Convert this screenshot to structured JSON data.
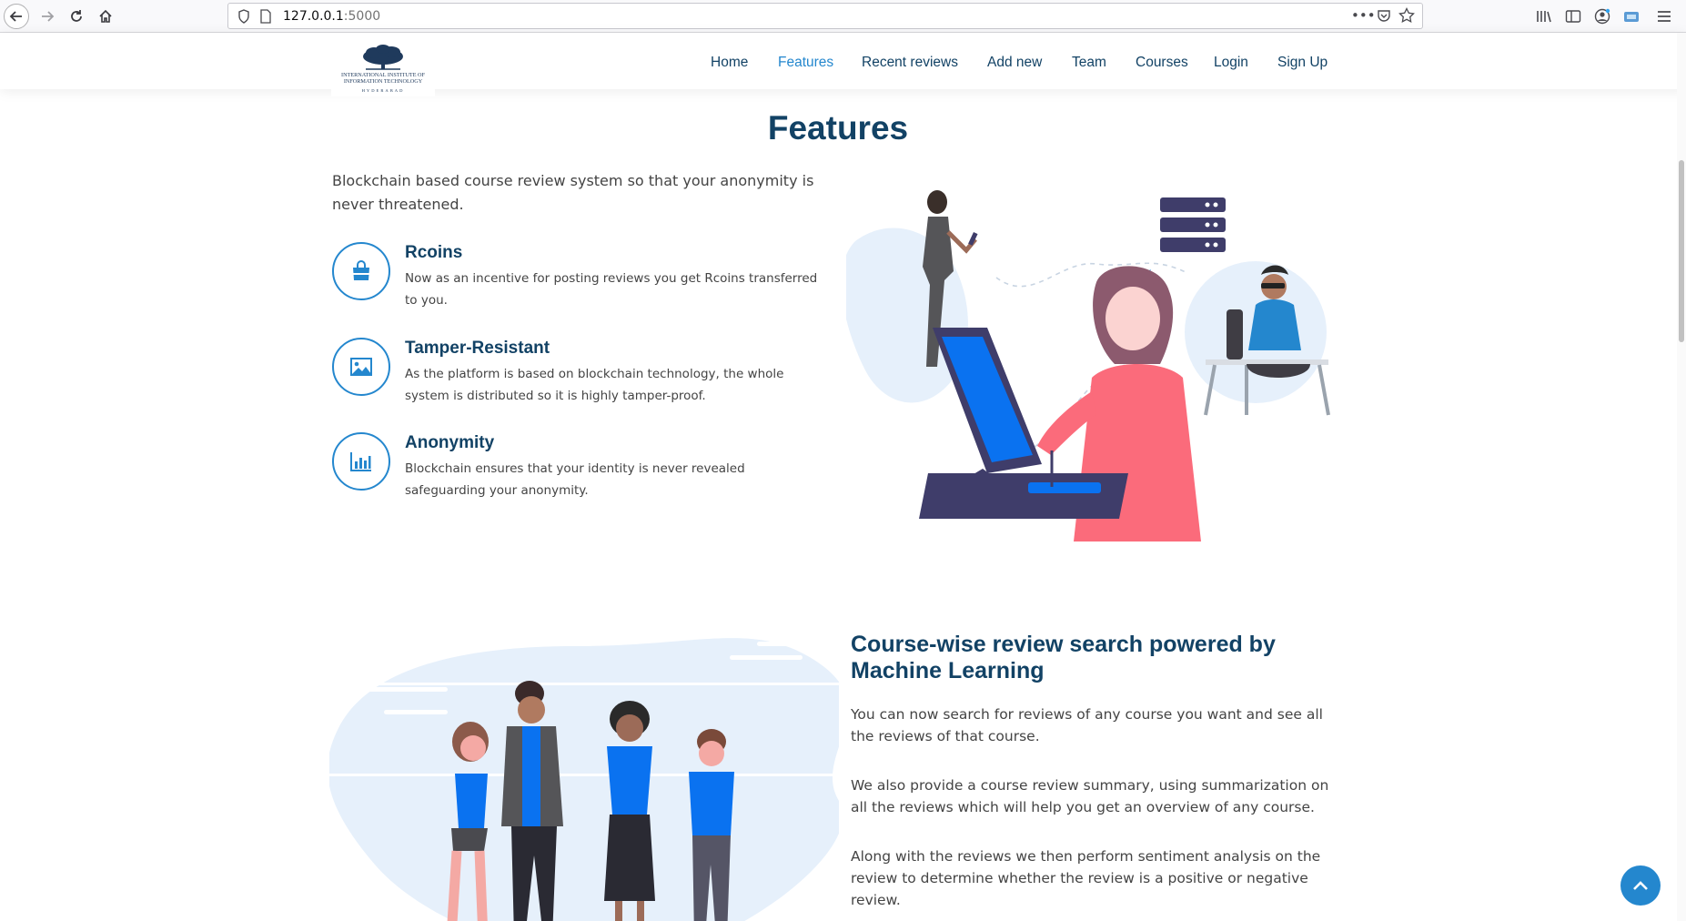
{
  "browser": {
    "url_host": "127.0.0.1",
    "url_port": ":5000"
  },
  "nav": {
    "items": [
      {
        "label": "Home",
        "active": false
      },
      {
        "label": "Features",
        "active": true
      },
      {
        "label": "Recent reviews",
        "active": false
      },
      {
        "label": "Add new",
        "active": false
      },
      {
        "label": "Team",
        "active": false
      },
      {
        "label": "Courses",
        "active": false
      },
      {
        "label": "Login",
        "active": false
      },
      {
        "label": "Sign Up",
        "active": false
      }
    ]
  },
  "logo": {
    "line1": "INTERNATIONAL INSTITUTE OF",
    "line2": "INFORMATION TECHNOLOGY",
    "line3": "HYDERABAD"
  },
  "features_section": {
    "title": "Features",
    "intro": "Blockchain based course review system so that your anonymity is never threatened.",
    "items": [
      {
        "title": "Rcoins",
        "description": "Now as an incentive for posting reviews you get Rcoins transferred to you.",
        "icon": "shopping-bag-icon"
      },
      {
        "title": "Tamper-Resistant",
        "description": "As the platform is based on blockchain technology, the whole system is distributed so it is highly tamper-proof.",
        "icon": "image-icon"
      },
      {
        "title": "Anonymity",
        "description": "Blockchain ensures that your identity is never revealed safeguarding your anonymity.",
        "icon": "bar-chart-icon"
      }
    ]
  },
  "ml_section": {
    "title": "Course-wise review search powered by Machine Learning",
    "paragraphs": [
      "You can now search for reviews of any course you want and see all the reviews of that course.",
      "We also provide a course review summary, using summarization on all the reviews which will help you get an overview of any course.",
      "Along with the reviews we then perform sentiment analysis on the review to determine whether the review is a positive or negative review."
    ]
  },
  "colors": {
    "accent": "#2487ce",
    "heading": "#124265",
    "text": "#444444"
  }
}
